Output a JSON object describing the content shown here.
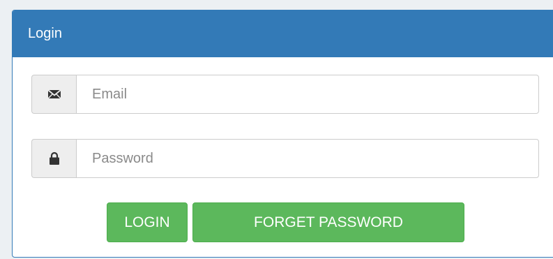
{
  "panel": {
    "title": "Login"
  },
  "form": {
    "email": {
      "icon": "envelope-icon",
      "placeholder": "Email",
      "value": ""
    },
    "password": {
      "icon": "lock-icon",
      "placeholder": "Password",
      "value": ""
    }
  },
  "buttons": {
    "login_label": "LOGIN",
    "forget_label": "FORGET PASSWORD"
  },
  "colors": {
    "heading_bg": "#337ab7",
    "button_bg": "#5cb85c",
    "page_bg": "#ecf0f3"
  }
}
